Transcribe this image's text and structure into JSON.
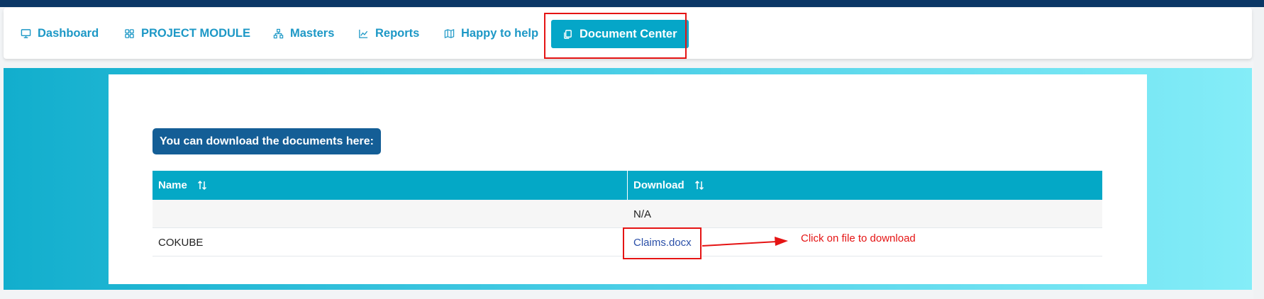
{
  "nav": {
    "items": [
      {
        "label": "Dashboard",
        "icon": "monitor-icon"
      },
      {
        "label": "PROJECT MODULE",
        "icon": "grid-icon"
      },
      {
        "label": "Masters",
        "icon": "hierarchy-icon"
      },
      {
        "label": "Reports",
        "icon": "line-chart-icon"
      },
      {
        "label": "Happy to help",
        "icon": "map-icon"
      },
      {
        "label": "Document Center",
        "icon": "documents-icon",
        "active": true
      }
    ]
  },
  "main": {
    "section_label": "You can download the documents here:",
    "table": {
      "columns": [
        "Name",
        "Download"
      ],
      "rows": [
        {
          "name": "",
          "download": "N/A"
        },
        {
          "name": "COKUBE",
          "download": "Claims.docx",
          "is_link": true
        }
      ]
    }
  },
  "annotation": {
    "text": "Click on file to download"
  },
  "colors": {
    "nav_text": "#1d98c6",
    "active_tab_bg": "#05a6c8",
    "label_bg": "#145e96",
    "table_header_bg": "#04a8c6",
    "highlight": "#e51414",
    "topbar": "#0b3766"
  }
}
